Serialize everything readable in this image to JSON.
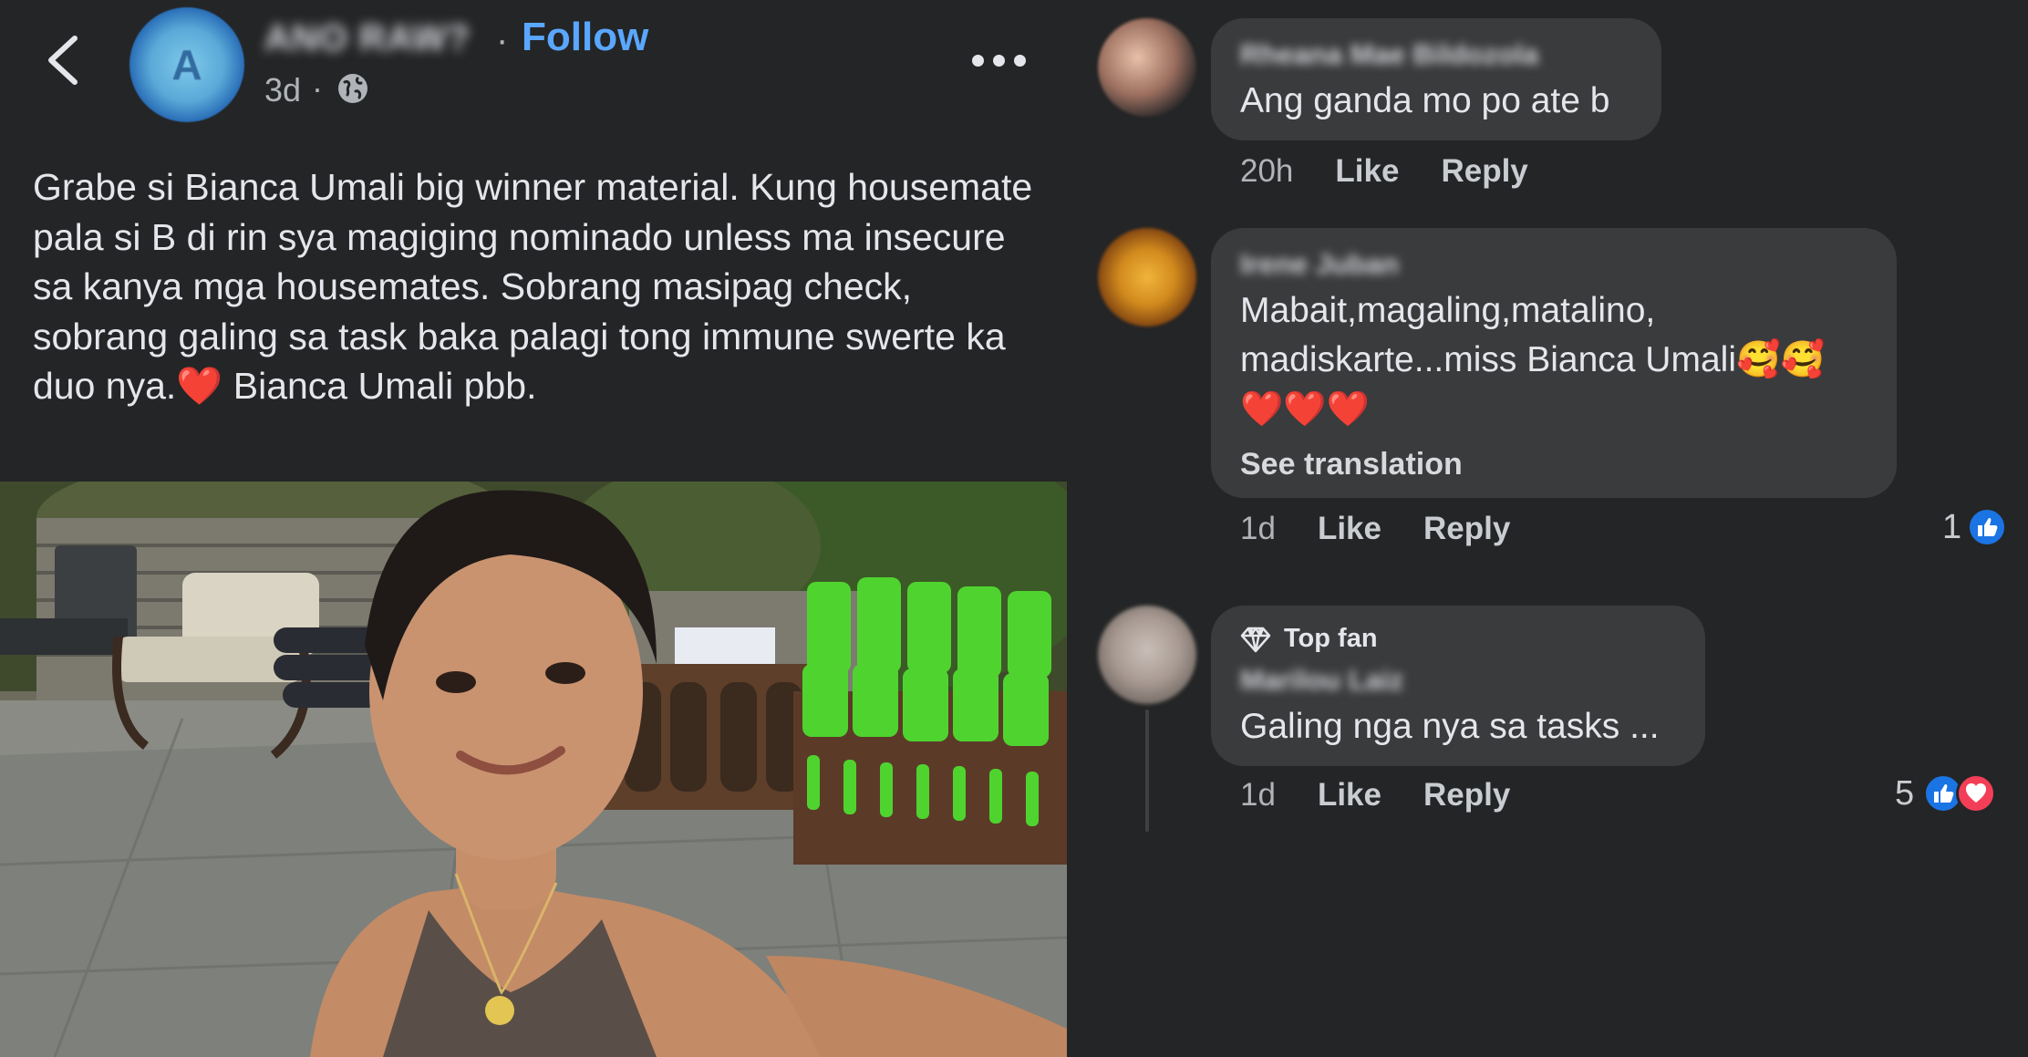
{
  "post": {
    "author_initial": "A",
    "author_name": "ANO RAW?",
    "separator": "·",
    "follow_label": "Follow",
    "time": "3d",
    "time_separator": "·",
    "body": "Grabe si Bianca Umali big winner material. Kung housemate pala si B di rin sya magiging nominado unless ma insecure sa kanya mga housemates. Sobrang masipag check, sobrang galing sa task baka palagi tong immune swerte ka duo nya.❤️ Bianca Umali pbb."
  },
  "comments": [
    {
      "author": "Rheana Mae Bildozola",
      "text": "Ang ganda mo po ate b",
      "time": "20h",
      "like_label": "Like",
      "reply_label": "Reply"
    },
    {
      "author": "Irene Juban",
      "text_line1": "Mabait,magaling,matalino,",
      "text_line2": "madiskarte...miss Bianca Umali🥰🥰",
      "text_line3": "❤️❤️❤️",
      "see_translation": "See translation",
      "time": "1d",
      "like_label": "Like",
      "reply_label": "Reply",
      "reaction_count": "1"
    },
    {
      "badge": "Top fan",
      "author": "Marilou Laiz",
      "text": "Galing nga nya sa tasks ...",
      "time": "1d",
      "like_label": "Like",
      "reply_label": "Reply",
      "reaction_count": "5"
    }
  ],
  "colors": {
    "background": "#242526",
    "bubble": "#3a3b3c",
    "follow_blue": "#5aa7ff",
    "like_blue": "#1b74e4",
    "love_red": "#f33e58"
  },
  "icons": [
    "back-arrow-icon",
    "globe-icon",
    "more-options-icon",
    "diamond-icon",
    "like-reaction-icon",
    "love-reaction-icon"
  ]
}
